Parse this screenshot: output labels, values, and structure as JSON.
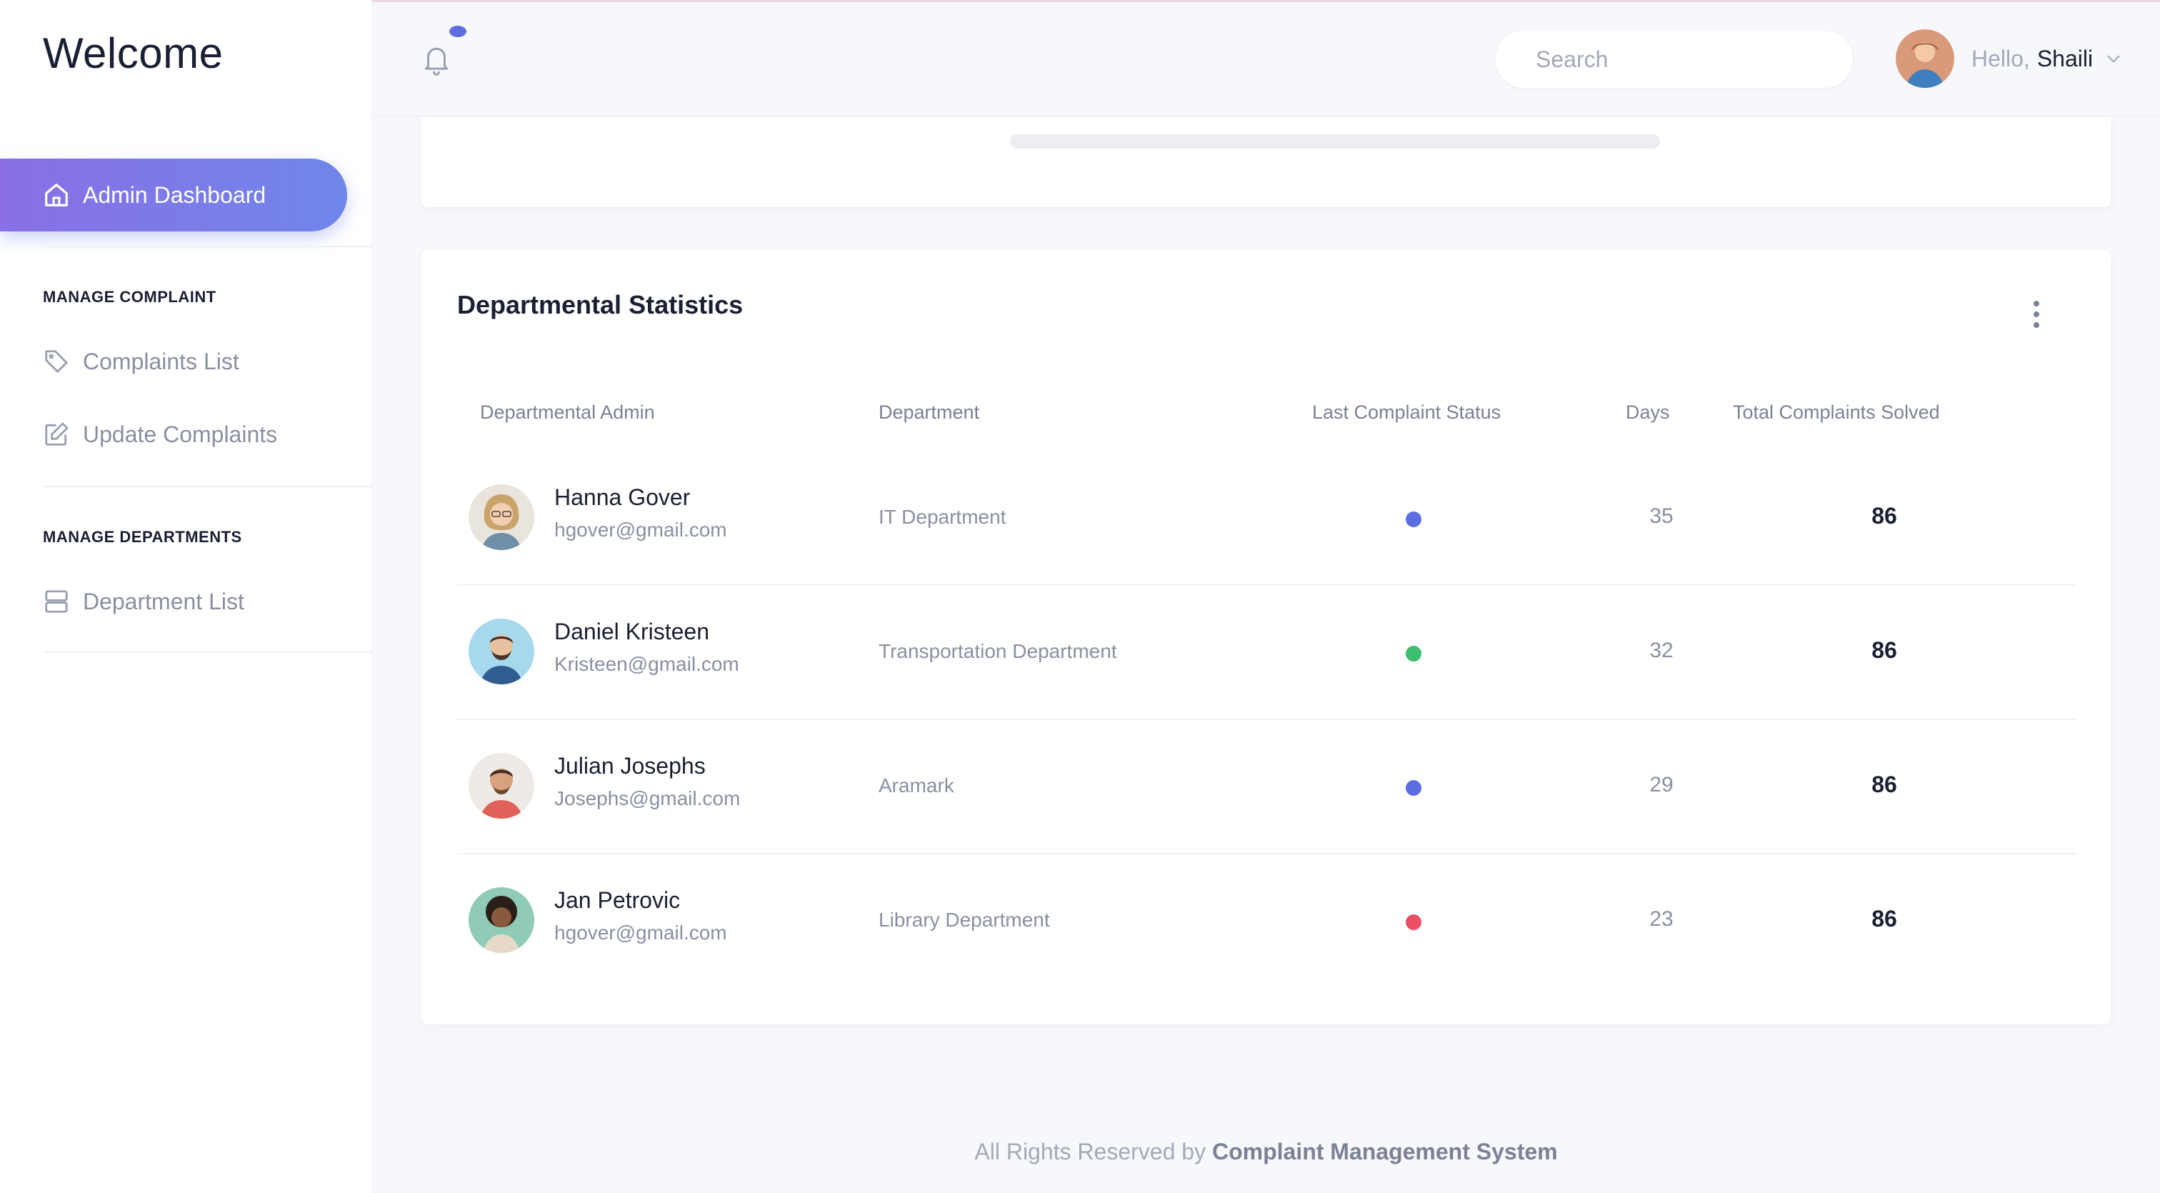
{
  "sidebar": {
    "brand": "Welcome",
    "active_item": {
      "label": "Admin Dashboard",
      "icon": "home-icon"
    },
    "sections": [
      {
        "title": "MANAGE COMPLAINT",
        "items": [
          {
            "label": "Complaints List",
            "icon": "tag-icon"
          },
          {
            "label": "Update Complaints",
            "icon": "edit-icon"
          }
        ]
      },
      {
        "title": "MANAGE DEPARTMENTS",
        "items": [
          {
            "label": "Department List",
            "icon": "server-icon"
          }
        ]
      }
    ]
  },
  "header": {
    "notification_icon": "bell-icon",
    "search": {
      "placeholder": "Search",
      "value": "",
      "icon": "search-icon"
    },
    "user": {
      "greeting": "Hello,",
      "name": "Shaili",
      "icon": "chevron-down-icon"
    }
  },
  "stats": {
    "title": "Departmental Statistics",
    "menu_icon": "more-vertical-icon",
    "columns": [
      "Departmental Admin",
      "Department",
      "Last Complaint Status",
      "Days",
      "Total Complaints Solved"
    ],
    "rows": [
      {
        "name": "Hanna Gover",
        "email": "hgover@gmail.com",
        "department": "IT Department",
        "status_color": "#5b6fe0",
        "days": "35",
        "total": "86"
      },
      {
        "name": "Daniel Kristeen",
        "email": "Kristeen@gmail.com",
        "department": "Transportation Department",
        "status_color": "#3dbd6f",
        "days": "32",
        "total": "86"
      },
      {
        "name": "Julian Josephs",
        "email": "Josephs@gmail.com",
        "department": "Aramark",
        "status_color": "#5b6fe0",
        "days": "29",
        "total": "86"
      },
      {
        "name": "Jan Petrovic",
        "email": "hgover@gmail.com",
        "department": "Library Department",
        "status_color": "#ea4f64",
        "days": "23",
        "total": "86"
      }
    ]
  },
  "footer": {
    "prefix": "All Rights Reserved by",
    "brand": "Complaint Management System"
  },
  "colors": {
    "accent_start": "#8a6fe6",
    "accent_end": "#6f86ea",
    "status_blue": "#5b6fe0",
    "status_green": "#3dbd6f",
    "status_red": "#ea4f64"
  }
}
